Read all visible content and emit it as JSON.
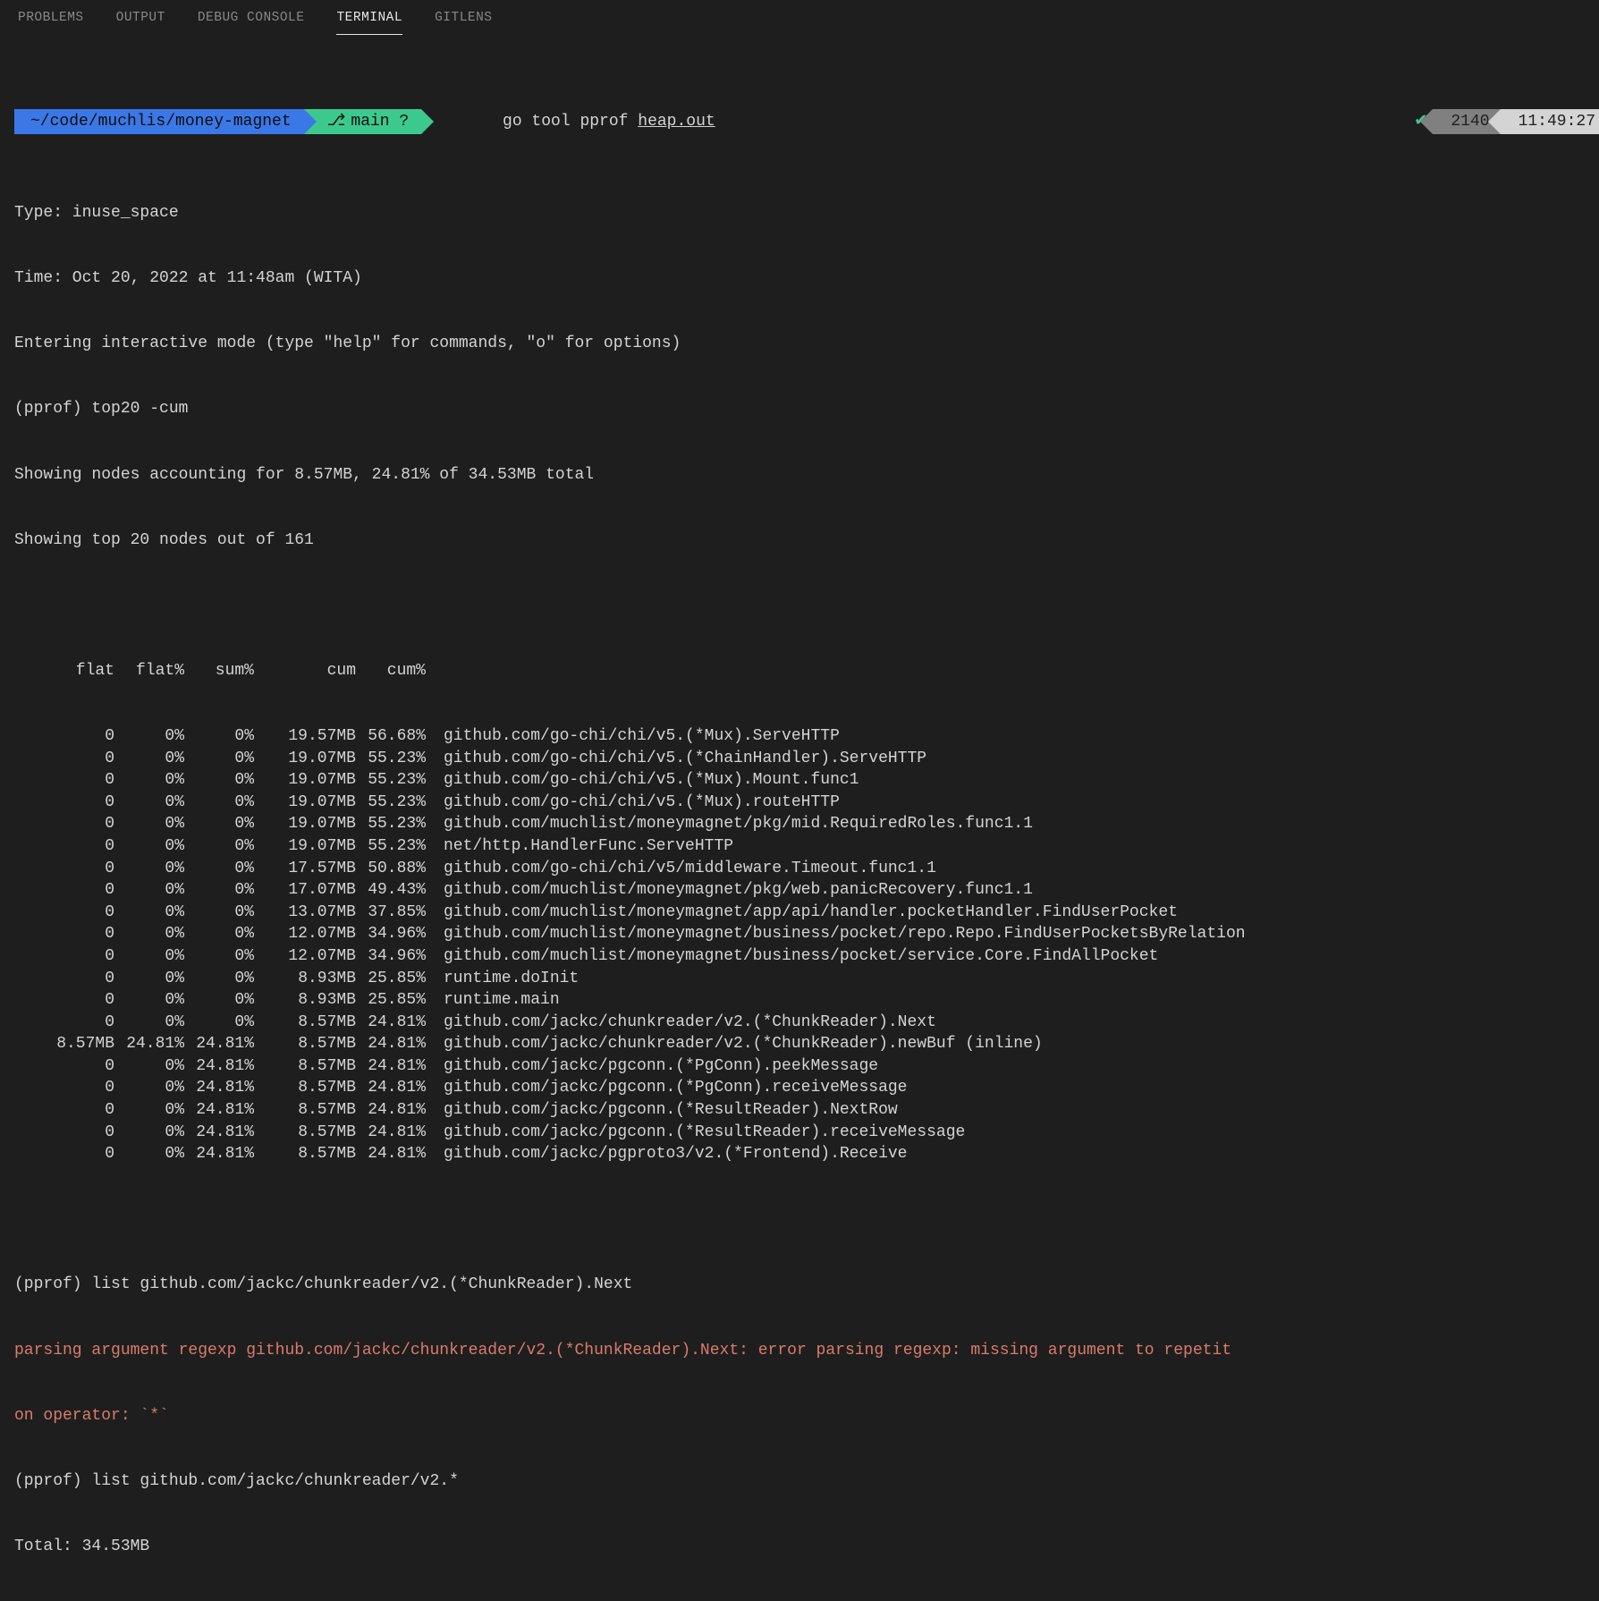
{
  "tabs": {
    "problems": "PROBLEMS",
    "output": "OUTPUT",
    "debug": "DEBUG CONSOLE",
    "terminal": "TERMINAL",
    "gitlens": "GITLENS"
  },
  "prompt": {
    "path": "~/code/muchlis/money-magnet",
    "branch_icon": "⎇",
    "branch": "main ?",
    "cmd_prefix": "go tool pprof ",
    "cmd_arg": "heap.out"
  },
  "status": {
    "check": "✔",
    "num": "2140",
    "time": "11:49:27"
  },
  "header_lines": [
    "Type: inuse_space",
    "Time: Oct 20, 2022 at 11:48am (WITA)",
    "Entering interactive mode (type \"help\" for commands, \"o\" for options)",
    "(pprof) top20 -cum",
    "Showing nodes accounting for 8.57MB, 24.81% of 34.53MB total",
    "Showing top 20 nodes out of 161"
  ],
  "table_header": {
    "flat": "flat",
    "flatp": "flat%",
    "sump": "sum%",
    "cum": "cum",
    "cump": "cum%"
  },
  "rows": [
    {
      "flat": "0",
      "flatp": "0%",
      "sump": "0%",
      "cum": "19.57MB",
      "cump": "56.68%",
      "fn": "github.com/go-chi/chi/v5.(*Mux).ServeHTTP"
    },
    {
      "flat": "0",
      "flatp": "0%",
      "sump": "0%",
      "cum": "19.07MB",
      "cump": "55.23%",
      "fn": "github.com/go-chi/chi/v5.(*ChainHandler).ServeHTTP"
    },
    {
      "flat": "0",
      "flatp": "0%",
      "sump": "0%",
      "cum": "19.07MB",
      "cump": "55.23%",
      "fn": "github.com/go-chi/chi/v5.(*Mux).Mount.func1"
    },
    {
      "flat": "0",
      "flatp": "0%",
      "sump": "0%",
      "cum": "19.07MB",
      "cump": "55.23%",
      "fn": "github.com/go-chi/chi/v5.(*Mux).routeHTTP"
    },
    {
      "flat": "0",
      "flatp": "0%",
      "sump": "0%",
      "cum": "19.07MB",
      "cump": "55.23%",
      "fn": "github.com/muchlist/moneymagnet/pkg/mid.RequiredRoles.func1.1"
    },
    {
      "flat": "0",
      "flatp": "0%",
      "sump": "0%",
      "cum": "19.07MB",
      "cump": "55.23%",
      "fn": "net/http.HandlerFunc.ServeHTTP"
    },
    {
      "flat": "0",
      "flatp": "0%",
      "sump": "0%",
      "cum": "17.57MB",
      "cump": "50.88%",
      "fn": "github.com/go-chi/chi/v5/middleware.Timeout.func1.1"
    },
    {
      "flat": "0",
      "flatp": "0%",
      "sump": "0%",
      "cum": "17.07MB",
      "cump": "49.43%",
      "fn": "github.com/muchlist/moneymagnet/pkg/web.panicRecovery.func1.1"
    },
    {
      "flat": "0",
      "flatp": "0%",
      "sump": "0%",
      "cum": "13.07MB",
      "cump": "37.85%",
      "fn": "github.com/muchlist/moneymagnet/app/api/handler.pocketHandler.FindUserPocket"
    },
    {
      "flat": "0",
      "flatp": "0%",
      "sump": "0%",
      "cum": "12.07MB",
      "cump": "34.96%",
      "fn": "github.com/muchlist/moneymagnet/business/pocket/repo.Repo.FindUserPocketsByRelation"
    },
    {
      "flat": "0",
      "flatp": "0%",
      "sump": "0%",
      "cum": "12.07MB",
      "cump": "34.96%",
      "fn": "github.com/muchlist/moneymagnet/business/pocket/service.Core.FindAllPocket"
    },
    {
      "flat": "0",
      "flatp": "0%",
      "sump": "0%",
      "cum": "8.93MB",
      "cump": "25.85%",
      "fn": "runtime.doInit"
    },
    {
      "flat": "0",
      "flatp": "0%",
      "sump": "0%",
      "cum": "8.93MB",
      "cump": "25.85%",
      "fn": "runtime.main"
    },
    {
      "flat": "0",
      "flatp": "0%",
      "sump": "0%",
      "cum": "8.57MB",
      "cump": "24.81%",
      "fn": "github.com/jackc/chunkreader/v2.(*ChunkReader).Next"
    },
    {
      "flat": "8.57MB",
      "flatp": "24.81%",
      "sump": "24.81%",
      "cum": "8.57MB",
      "cump": "24.81%",
      "fn": "github.com/jackc/chunkreader/v2.(*ChunkReader).newBuf (inline)"
    },
    {
      "flat": "0",
      "flatp": "0%",
      "sump": "24.81%",
      "cum": "8.57MB",
      "cump": "24.81%",
      "fn": "github.com/jackc/pgconn.(*PgConn).peekMessage"
    },
    {
      "flat": "0",
      "flatp": "0%",
      "sump": "24.81%",
      "cum": "8.57MB",
      "cump": "24.81%",
      "fn": "github.com/jackc/pgconn.(*PgConn).receiveMessage"
    },
    {
      "flat": "0",
      "flatp": "0%",
      "sump": "24.81%",
      "cum": "8.57MB",
      "cump": "24.81%",
      "fn": "github.com/jackc/pgconn.(*ResultReader).NextRow"
    },
    {
      "flat": "0",
      "flatp": "0%",
      "sump": "24.81%",
      "cum": "8.57MB",
      "cump": "24.81%",
      "fn": "github.com/jackc/pgconn.(*ResultReader).receiveMessage"
    },
    {
      "flat": "0",
      "flatp": "0%",
      "sump": "24.81%",
      "cum": "8.57MB",
      "cump": "24.81%",
      "fn": "github.com/jackc/pgproto3/v2.(*Frontend).Receive"
    }
  ],
  "footer": {
    "list1": "(pprof) list github.com/jackc/chunkreader/v2.(*ChunkReader).Next",
    "err1": "parsing argument regexp github.com/jackc/chunkreader/v2.(*ChunkReader).Next: error parsing regexp: missing argument to repetit",
    "err2": "on operator: `*`",
    "list2": "(pprof) list github.com/jackc/chunkreader/v2.*",
    "total": "Total: 34.53MB"
  }
}
